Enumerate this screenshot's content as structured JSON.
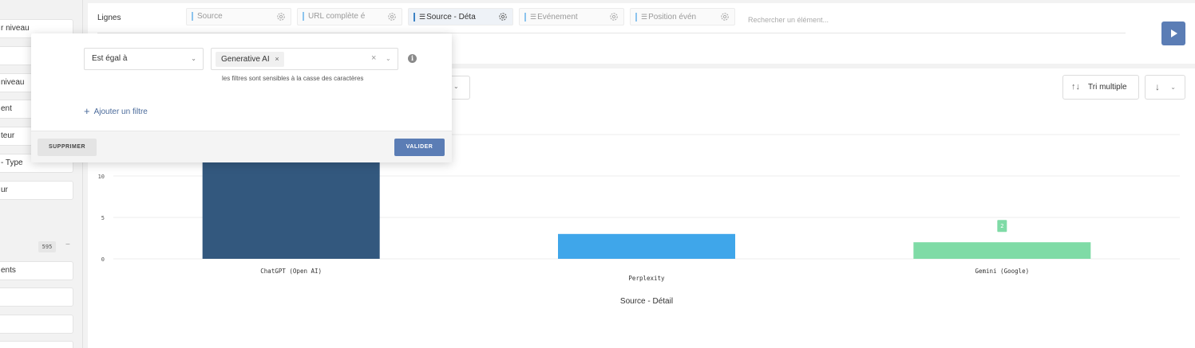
{
  "sidebar": {
    "items": [
      {
        "label": "r niveau"
      },
      {
        "label": ""
      },
      {
        "label": " niveau"
      },
      {
        "label": "ent"
      },
      {
        "label": "teur"
      },
      {
        "label": "- Type"
      },
      {
        "label": "ur"
      },
      {
        "label": "ents"
      },
      {
        "label": ""
      },
      {
        "label": ""
      },
      {
        "label": ""
      }
    ],
    "count": "595",
    "collapse_glyph": "−"
  },
  "rows_bar": {
    "label": "Lignes",
    "chips": [
      {
        "label": "Source",
        "active": false,
        "sort": false
      },
      {
        "label": "URL complète é",
        "active": false,
        "sort": false
      },
      {
        "label": "Source - Déta",
        "active": true,
        "sort": true
      },
      {
        "label": "Evénement",
        "active": false,
        "sort": true
      },
      {
        "label": "Position évén",
        "active": false,
        "sort": true
      }
    ],
    "search_placeholder": "Rechercher un élément...",
    "run_icon": "play-icon"
  },
  "chart_toolbar": {
    "sort_label": "Tri multiple",
    "sort_icon": "sort-arrows-icon",
    "direction_icon": "arrow-down-icon",
    "direction_glyph": "↓"
  },
  "filter_popup": {
    "operator": "Est égal à",
    "value_tag": "Generative AI",
    "case_hint": "les filtres sont sensibles à la casse des caractères",
    "add_filter": "Ajouter un filtre",
    "delete_label": "SUPPRIMER",
    "validate_label": "VALIDER"
  },
  "chart_data": {
    "type": "bar",
    "categories": [
      "ChatGPT (Open AI)",
      "Perplexity",
      "Gemini (Google)"
    ],
    "values": [
      17,
      3,
      2
    ],
    "colors": [
      "#33587e",
      "#3fa6ea",
      "#7fdba6"
    ],
    "data_labels": [
      "",
      "",
      "2"
    ],
    "xlabel": "Source - Détail",
    "ylabel": "",
    "yticks": [
      0,
      5,
      10
    ],
    "ylim": [
      0,
      20
    ],
    "grid": true
  }
}
